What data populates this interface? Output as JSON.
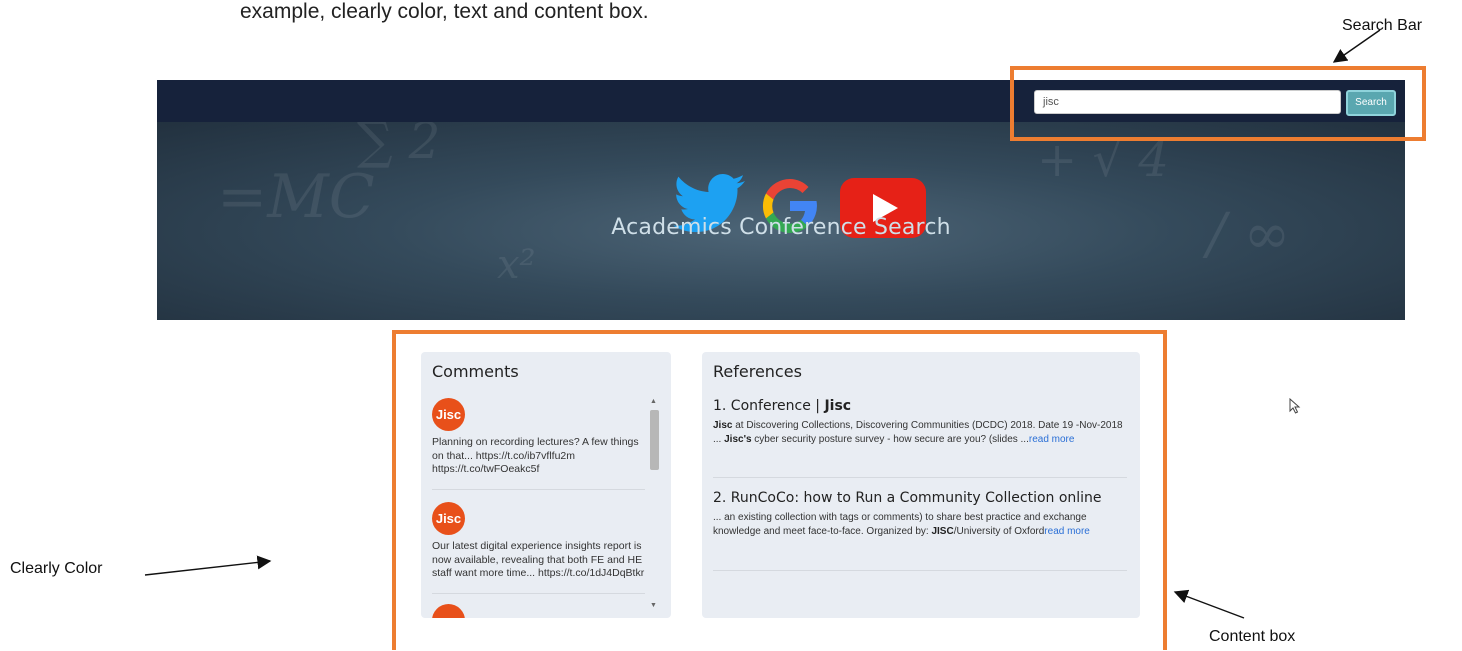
{
  "intro_text": "example, clearly color, text and content box.",
  "header": {
    "search_value": "jisc",
    "search_button_label": "Search"
  },
  "hero": {
    "title": "Academics Conference Search",
    "logos": [
      "twitter-icon",
      "google-icon",
      "youtube-icon"
    ]
  },
  "comments": {
    "title": "Comments",
    "items": [
      {
        "author": "Jisc",
        "text": "Planning on recording lectures? A few things on that... https://t.co/ib7vflfu2m https://t.co/twFOeakc5f"
      },
      {
        "author": "Jisc",
        "text": "Our latest digital experience insights report is now available, revealing that both FE and HE staff want more time... https://t.co/1dJ4DqBtkr"
      }
    ]
  },
  "references": {
    "title": "References",
    "items": [
      {
        "title_prefix": "1. Conference | ",
        "title_bold": "Jisc",
        "s1_b": "Jisc",
        "s1": " at Discovering Collections, Discovering Communities (DCDC) 2018. Date 19 -Nov-2018 ... ",
        "s2_b": "Jisc's",
        "s2": " cyber security posture survey - how secure are you? (slides ...",
        "read_more": "read more"
      },
      {
        "title_prefix": "2. RunCoCo: how to Run a Community Collection online",
        "s1": "... an existing collection with tags or comments) to share best practice and exchange knowledge and meet face-to-face. Organized by: ",
        "s1_b": "JISC",
        "s2": "/University of Oxford",
        "read_more": "read more"
      }
    ]
  },
  "annotations": {
    "search_bar": "Search Bar",
    "clearly_color": "Clearly Color",
    "content_box": "Content box"
  },
  "colors": {
    "highlight": "#ed7d31",
    "navbar": "#16223b",
    "search_button": "#5aa7b0",
    "jisc_badge": "#e8501a",
    "link": "#2a6fd6"
  }
}
